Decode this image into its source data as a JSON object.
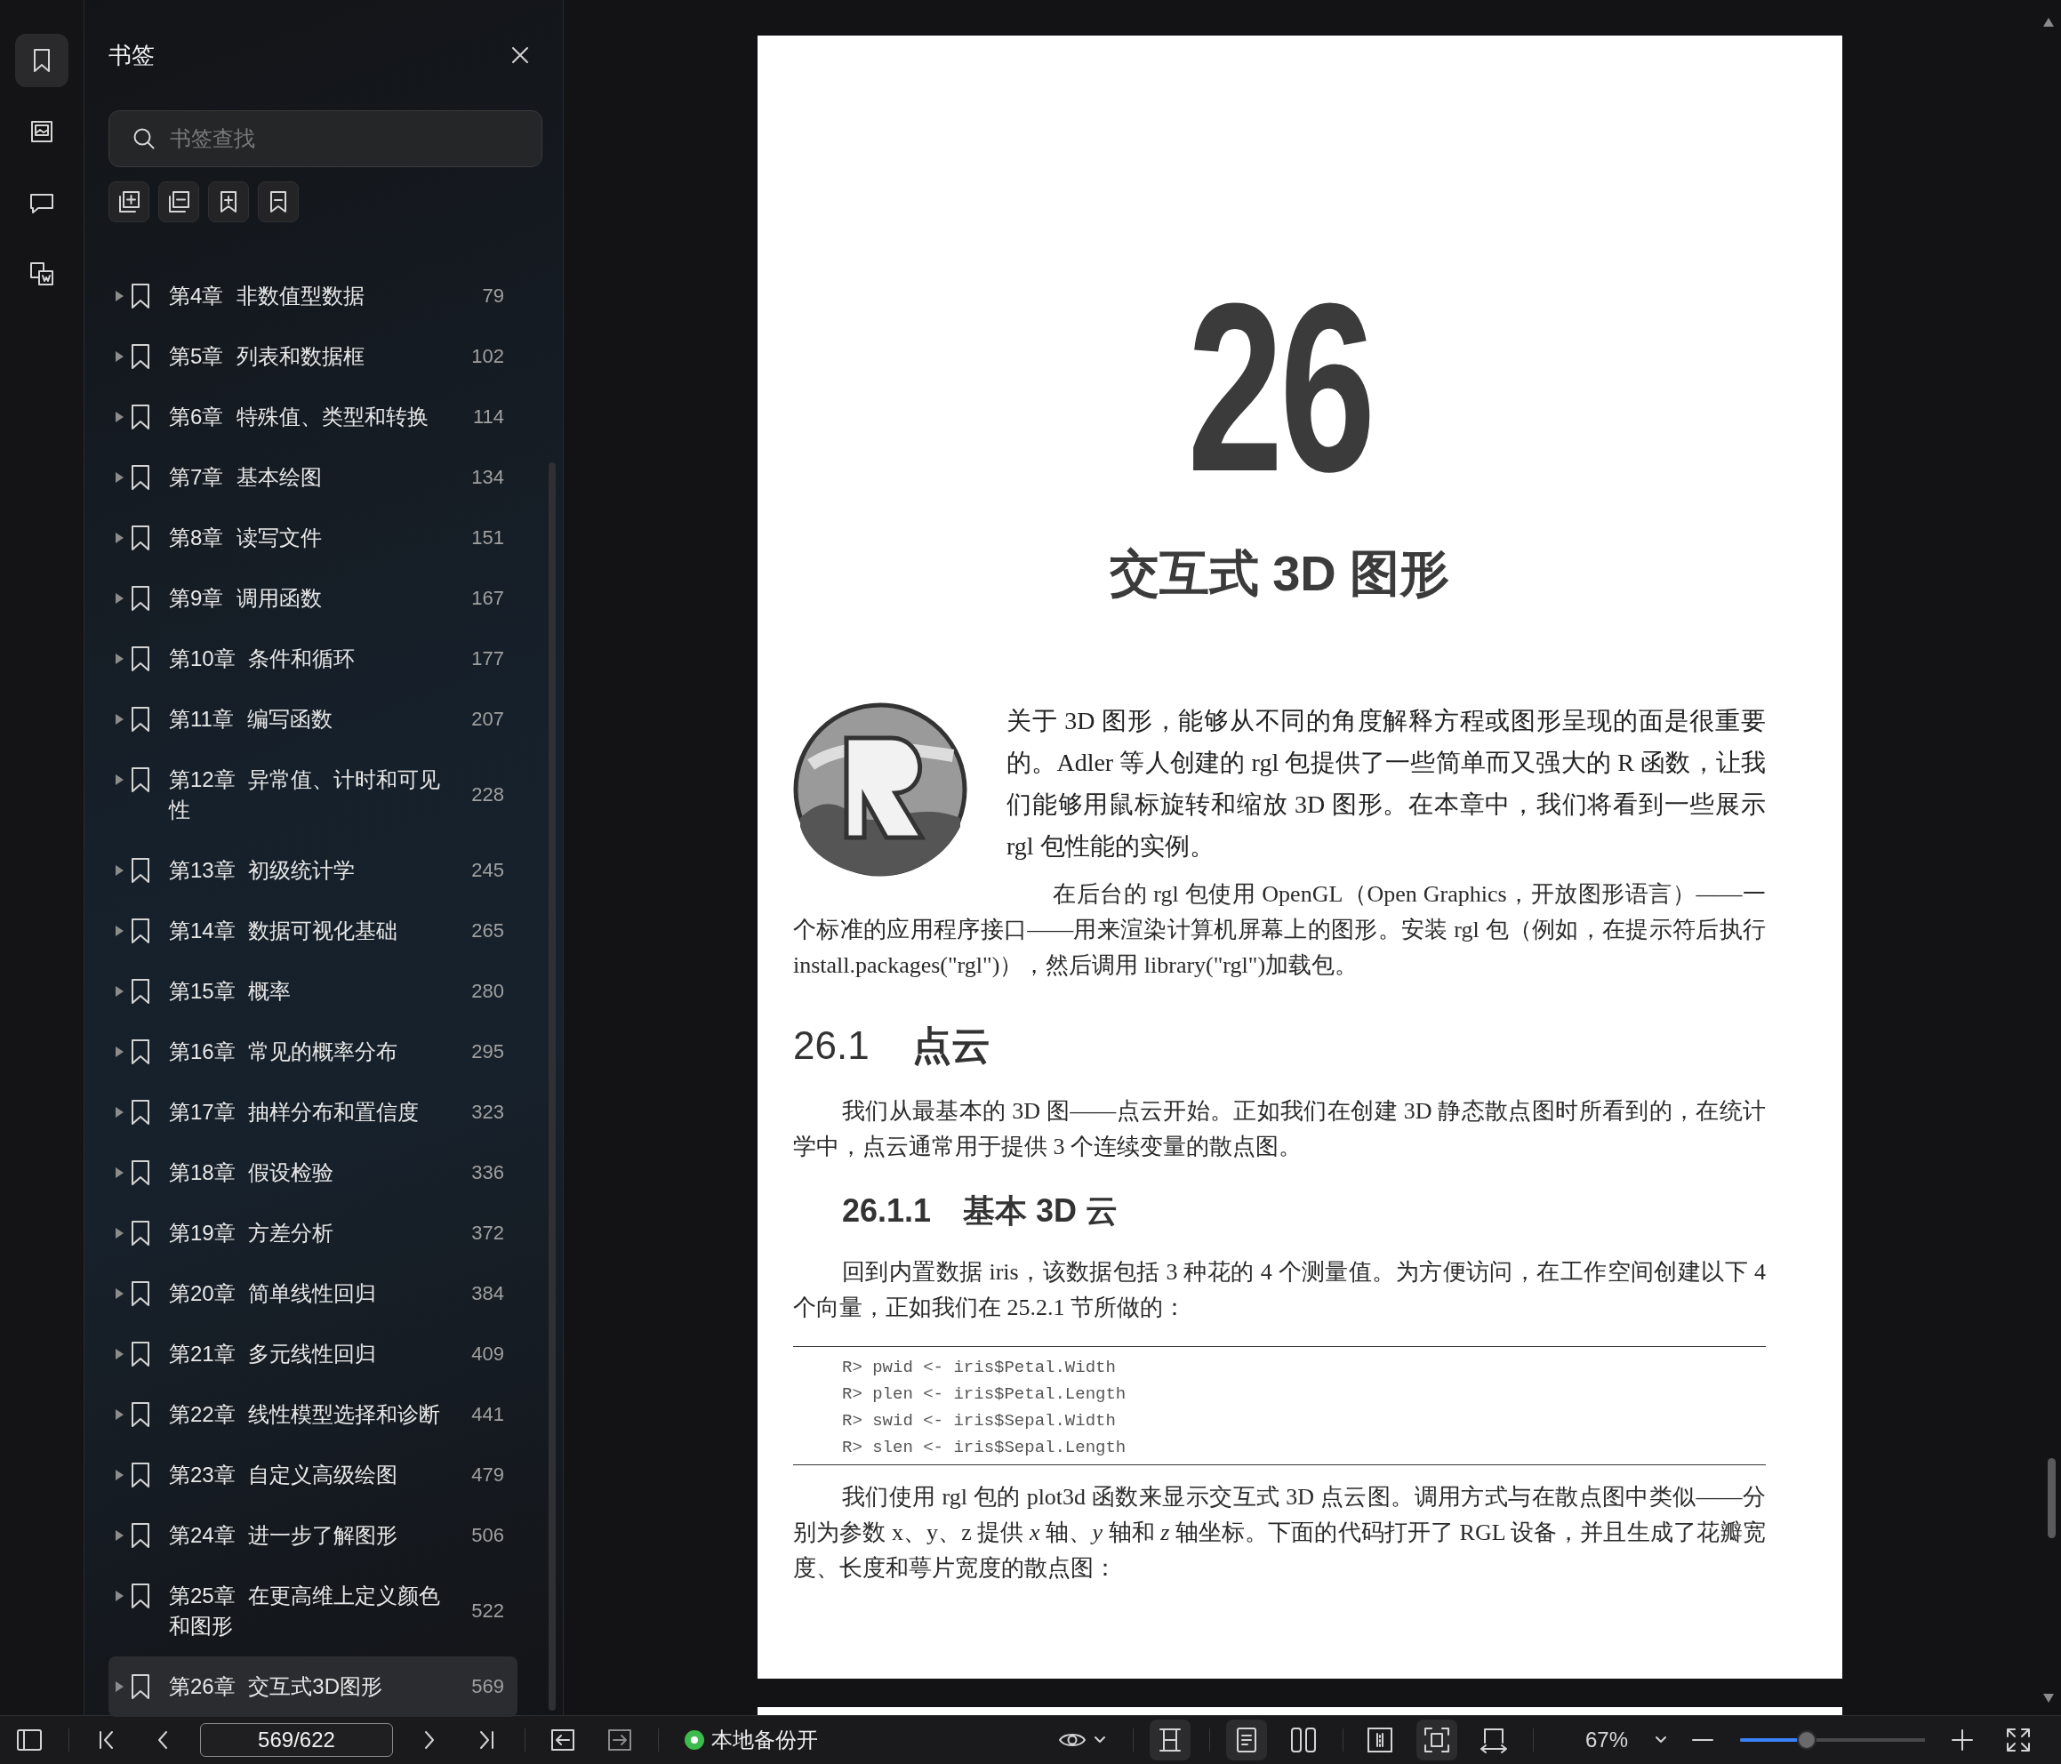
{
  "rail": [
    {
      "kind": "bookmarks",
      "selected": true
    },
    {
      "kind": "thumbnails",
      "selected": false
    },
    {
      "kind": "comments",
      "selected": false
    },
    {
      "kind": "convert",
      "selected": false
    }
  ],
  "sidebar": {
    "title": "书签",
    "search": {
      "placeholder": "书签查找"
    },
    "bookmarks": [
      {
        "label": "第4章 非数值型数据",
        "page": "79",
        "expanded": false,
        "selected": false
      },
      {
        "label": "第5章 列表和数据框",
        "page": "102",
        "expanded": false,
        "selected": false
      },
      {
        "label": "第6章 特殊值、类型和转换",
        "page": "114",
        "expanded": false,
        "selected": false
      },
      {
        "label": "第7章 基本绘图",
        "page": "134",
        "expanded": false,
        "selected": false
      },
      {
        "label": "第8章 读写文件",
        "page": "151",
        "expanded": false,
        "selected": false
      },
      {
        "label": "第9章 调用函数",
        "page": "167",
        "expanded": false,
        "selected": false
      },
      {
        "label": "第10章 条件和循环",
        "page": "177",
        "expanded": false,
        "selected": false
      },
      {
        "label": "第11章 编写函数",
        "page": "207",
        "expanded": false,
        "selected": false
      },
      {
        "label": "第12章 异常值、计时和可见性",
        "page": "228",
        "expanded": false,
        "selected": false
      },
      {
        "label": "第13章 初级统计学",
        "page": "245",
        "expanded": false,
        "selected": false
      },
      {
        "label": "第14章 数据可视化基础",
        "page": "265",
        "expanded": false,
        "selected": false
      },
      {
        "label": "第15章 概率",
        "page": "280",
        "expanded": false,
        "selected": false
      },
      {
        "label": "第16章 常见的概率分布",
        "page": "295",
        "expanded": false,
        "selected": false
      },
      {
        "label": "第17章 抽样分布和置信度",
        "page": "323",
        "expanded": false,
        "selected": false
      },
      {
        "label": "第18章 假设检验",
        "page": "336",
        "expanded": false,
        "selected": false
      },
      {
        "label": "第19章 方差分析",
        "page": "372",
        "expanded": false,
        "selected": false
      },
      {
        "label": "第20章 简单线性回归",
        "page": "384",
        "expanded": false,
        "selected": false
      },
      {
        "label": "第21章 多元线性回归",
        "page": "409",
        "expanded": false,
        "selected": false
      },
      {
        "label": "第22章 线性模型选择和诊断",
        "page": "441",
        "expanded": false,
        "selected": false
      },
      {
        "label": "第23章 自定义高级绘图",
        "page": "479",
        "expanded": false,
        "selected": false
      },
      {
        "label": "第24章 进一步了解图形",
        "page": "506",
        "expanded": false,
        "selected": false
      },
      {
        "label": "第25章 在更高维上定义颜色和图形",
        "page": "522",
        "expanded": false,
        "selected": false
      },
      {
        "label": "第26章 交互式3D图形",
        "page": "569",
        "expanded": false,
        "selected": true
      }
    ]
  },
  "document": {
    "chapter_number": "26",
    "chapter_title": "交互式 3D 图形",
    "blocks": [
      {
        "kind": "lead",
        "text": "关于 3D 图形，能够从不同的角度解释方程或图形呈现的面是很重要的。Adler 等人创建的 rgl 包提供了一些简单而又强大的 R 函数，让我们能够用鼠标旋转和缩放 3D 图形。在本章中，我们将看到一些展示 rgl 包性能的实例。"
      },
      {
        "kind": "after-lead",
        "text": "在后台的 rgl 包使用 OpenGL（Open Graphics，开放图形语言）——一个标准的应用程序接口——用来渲染计算机屏幕上的图形。安装 rgl 包（例如，在提示符后执行 install.packages(\"rgl\")），然后调用 library(\"rgl\")加载包。"
      },
      {
        "kind": "heading",
        "number": "26.1",
        "text": "点云"
      },
      {
        "kind": "para",
        "text": "我们从最基本的 3D 图——点云开始。正如我们在创建 3D 静态散点图时所看到的，在统计学中，点云通常用于提供 3 个连续变量的散点图。"
      },
      {
        "kind": "subheading",
        "number": "26.1.1",
        "text": "基本 3D 云"
      },
      {
        "kind": "para",
        "text": "回到内置数据 iris，该数据包括 3 种花的 4 个测量值。为方便访问，在工作空间创建以下 4 个向量，正如我们在 25.2.1 节所做的："
      },
      {
        "kind": "code",
        "lines": [
          "R> pwid <- iris$Petal.Width",
          "R> plen <- iris$Petal.Length",
          "R> swid <- iris$Sepal.Width",
          "R> slen <- iris$Sepal.Length"
        ]
      },
      {
        "kind": "para",
        "text": "我们使用 rgl 包的 plot3d 函数来显示交互式 3D 点云图。调用方式与在散点图中类似——分别为参数 x、y、z 提供 *x* 轴、*y* 轴和 *z* 轴坐标。下面的代码打开了 RGL 设备，并且生成了花瓣宽度、长度和萼片宽度的散点图："
      }
    ]
  },
  "toolbar": {
    "page_field": "569/622",
    "backup": {
      "label": "本地备份开",
      "on": true
    },
    "view_buttons": [
      {
        "kind": "scroll",
        "selected": true
      },
      {
        "kind": "single",
        "selected": true
      },
      {
        "kind": "double",
        "selected": false
      },
      {
        "kind": "columns",
        "selected": false
      },
      {
        "kind": "fit",
        "selected": true
      },
      {
        "kind": "width",
        "selected": false
      }
    ],
    "zoom": {
      "value": "67%",
      "level": 0.36
    }
  }
}
